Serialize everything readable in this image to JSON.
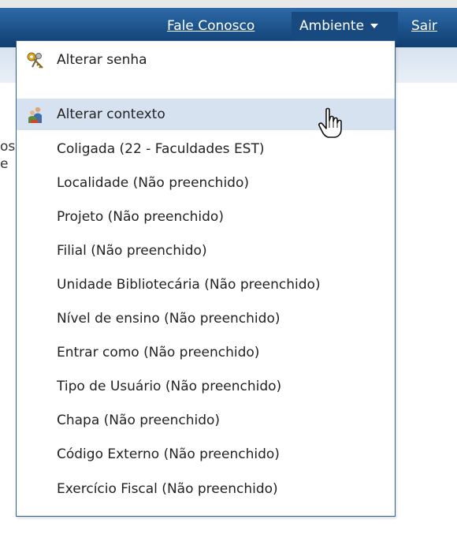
{
  "header": {
    "contact_link": "Fale Conosco",
    "environment_menu": "Ambiente",
    "exit_link": "Sair"
  },
  "background_fragments": [
    "os",
    "e"
  ],
  "menu": {
    "change_password": "Alterar senha",
    "change_context": "Alterar contexto",
    "context_items": [
      "Coligada (22 - Faculdades EST)",
      "Localidade (Não preenchido)",
      "Projeto (Não preenchido)",
      "Filial (Não preenchido)",
      "Unidade Bibliotecária (Não preenchido)",
      "Nível de ensino (Não preenchido)",
      "Entrar como (Não preenchido)",
      "Tipo de Usuário (Não preenchido)",
      "Chapa (Não preenchido)",
      "Código Externo (Não preenchido)",
      "Exercício Fiscal (Não preenchido)"
    ]
  },
  "colors": {
    "header_blue": "#1b5189",
    "menu_highlight": "#d6e2ef",
    "menu_border": "#2f5f95"
  }
}
